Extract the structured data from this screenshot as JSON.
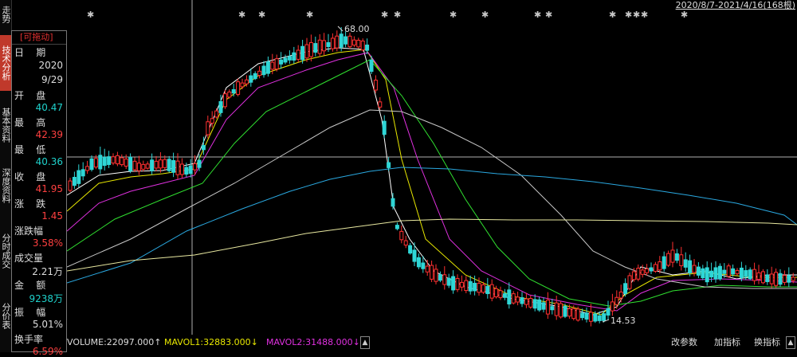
{
  "left_tabs": [
    {
      "label": "走势",
      "active": false
    },
    {
      "label": "技术分析",
      "active": true
    },
    {
      "label": "基本资料",
      "active": false
    },
    {
      "label": "深度资料",
      "active": false
    },
    {
      "label": "分时成交",
      "active": false
    },
    {
      "label": "分价表",
      "active": false
    }
  ],
  "panel": {
    "header": "[可拖动]",
    "date_label": "日    期",
    "date_year": "2020",
    "date_md": "9/29",
    "open_label": "开    盘",
    "open": "40.47",
    "high_label": "最    高",
    "high": "42.39",
    "low_label": "最    低",
    "low": "40.36",
    "close_label": "收    盘",
    "close": "41.95",
    "change_label": "涨    跌",
    "change": "1.45",
    "pct_label": "涨跌幅",
    "pct": "3.58%",
    "volume_label": "成交量",
    "volume": "2.21万",
    "amount_label": "金    额",
    "amount": "9238万",
    "amplitude_label": "振    幅",
    "amplitude": "5.01%",
    "turnover_label": "换手率",
    "turnover": "6.59%"
  },
  "header": {
    "date_range": "2020/8/7-2021/4/16(168根)"
  },
  "chart": {
    "high_label": "68.00",
    "low_label": "14.53",
    "colors": {
      "up": "#ff3030",
      "down": "#2fd6d6",
      "ma1": "#ffffff",
      "ma2": "#e8e800",
      "ma3": "#e030e0",
      "ma4": "#30e030",
      "ma5": "#c8c8c8",
      "ma6": "#2aa8e0",
      "ma7": "#e8e8a0",
      "crosshair": "#b0b0b0",
      "stars": "#c8c8c8"
    }
  },
  "bottom": {
    "volume": "VOLUME:22097.000",
    "mavol1": "MAVOL1:32883.000",
    "mavol2": "MAVOL2:31488.000",
    "btn_params": "改参数",
    "btn_add": "加指标",
    "btn_swap": "换指标",
    "up_arrow": "↑",
    "down_arrow": "↓"
  }
}
